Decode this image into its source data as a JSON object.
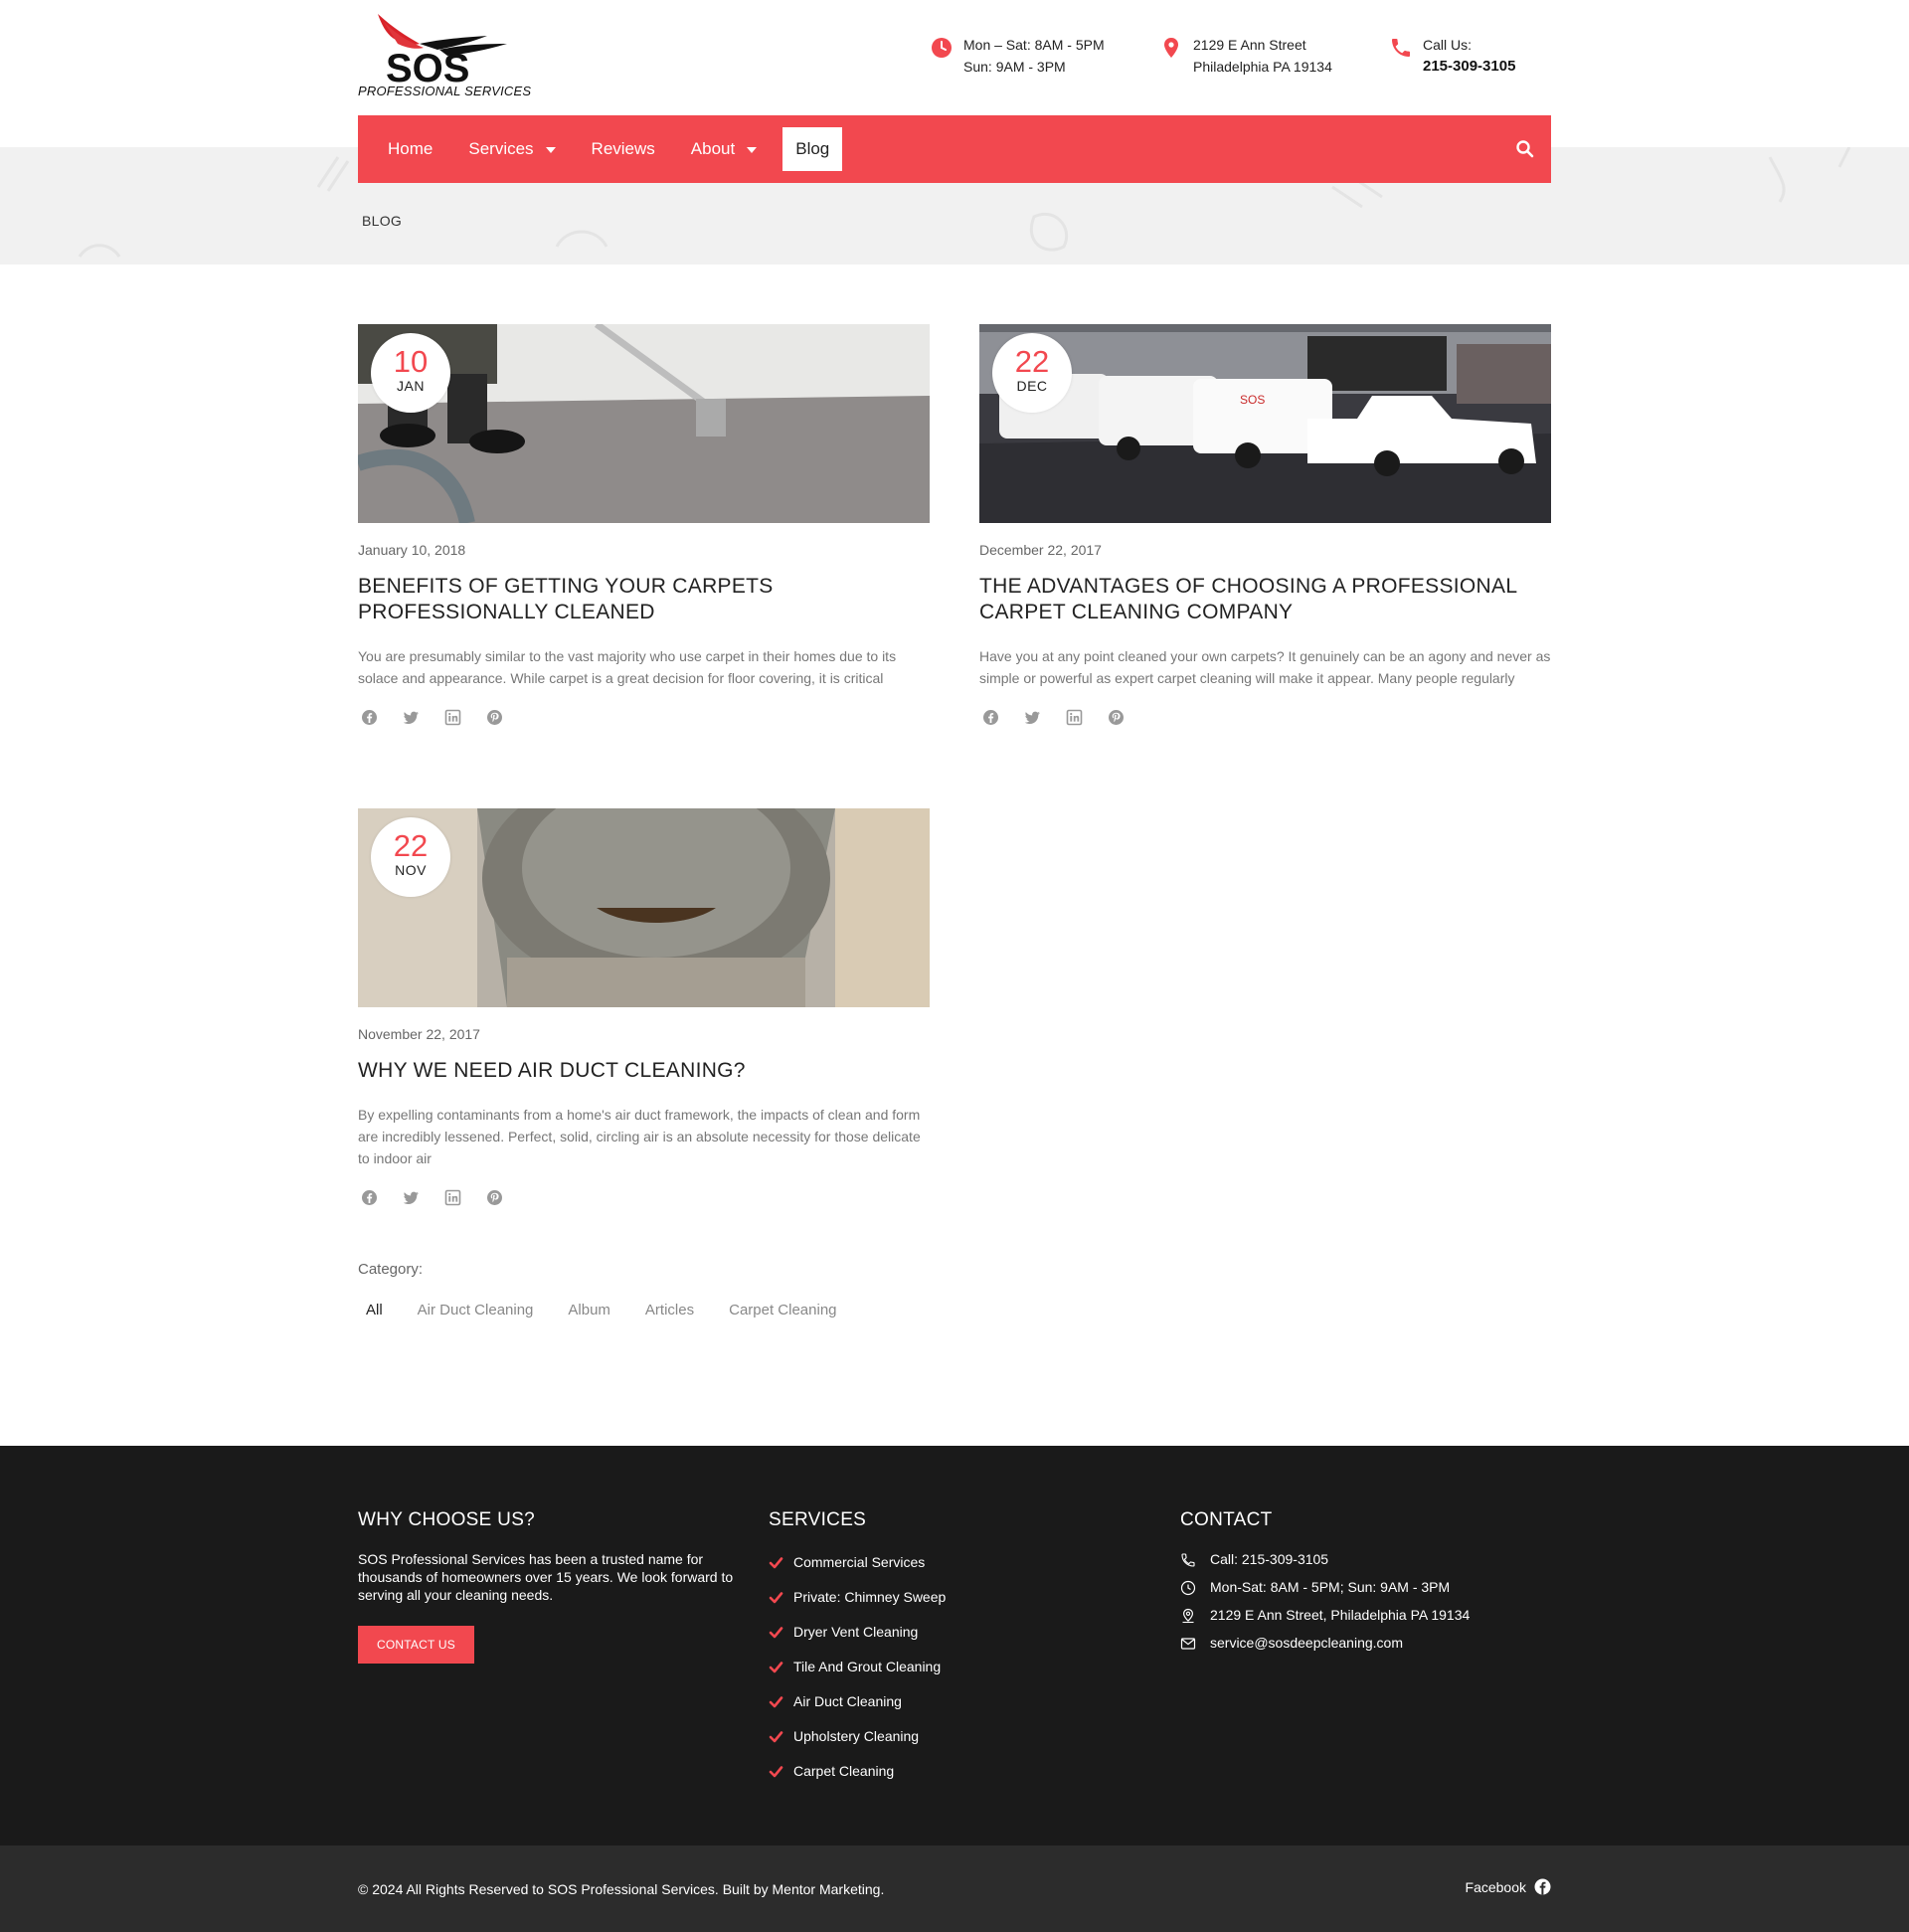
{
  "header": {
    "logo_text": "SOS",
    "logo_subtitle": "PROFESSIONAL SERVICES",
    "hours": [
      "Mon – Sat: 8AM - 5PM",
      "Sun: 9AM - 3PM"
    ],
    "address": [
      "2129 E Ann Street",
      "Philadelphia PA 19134"
    ],
    "call_label": "Call Us:",
    "call_number": "215-309-3105"
  },
  "nav": {
    "items": [
      {
        "label": "Home"
      },
      {
        "label": "Services"
      },
      {
        "label": "Reviews"
      },
      {
        "label": "About"
      },
      {
        "label": "Blog"
      }
    ]
  },
  "breadcrumb": "BLOG",
  "posts": [
    {
      "day": "10",
      "month": "JAN",
      "date": "January 10, 2018",
      "title": "Benefits of Getting your Carpets Professionally Cleaned",
      "excerpt": "You are presumably similar to the vast majority who use carpet  in  their homes due to its solace and appearance. While carpet is a great decision for floor covering, it is critical"
    },
    {
      "day": "22",
      "month": "DEC",
      "date": "December 22, 2017",
      "title": "The Advantages of Choosing a Professional Carpet Cleaning Company",
      "excerpt": "Have you at any point cleaned your own carpets? It genuinely can be an agony and never as simple or powerful as expert carpet cleaning will make it appear. Many people regularly"
    },
    {
      "day": "22",
      "month": "NOV",
      "date": "November 22, 2017",
      "title": "Why We Need Air Duct Cleaning?",
      "excerpt": "By expelling contaminants from a home's air duct framework, the impacts of clean and form are incredibly lessened. Perfect, solid, circling air is an absolute necessity for those delicate to indoor air"
    }
  ],
  "category": {
    "label": "Category:",
    "tabs": [
      "All",
      "Air Duct Cleaning",
      "Album",
      "Articles",
      "Carpet Cleaning"
    ]
  },
  "footer": {
    "why_title": "WHY CHOOSE US?",
    "why_text": "SOS Professional Services has been a trusted name for thousands of homeowners over 15 years. We look forward to serving all your cleaning needs.",
    "contact_button": "CONTACT US",
    "services_title": "SERVICES",
    "services": [
      "Commercial Services",
      "Private: Chimney Sweep",
      "Dryer Vent Cleaning",
      "Tile And Grout Cleaning",
      "Air Duct Cleaning",
      "Upholstery Cleaning",
      "Carpet Cleaning"
    ],
    "contact_title": "CONTACT",
    "contact": [
      "Call: 215-309-3105",
      "Mon-Sat: 8AM - 5PM; Sun: 9AM - 3PM",
      "2129 E Ann Street, Philadelphia PA 19134",
      "service@sosdeepcleaning.com"
    ],
    "copyright": "© 2024 All Rights Reserved to SOS Professional Services. Built by Mentor Marketing.",
    "facebook_label": "Facebook"
  },
  "colors": {
    "accent": "#f2484f",
    "footer_bg": "#1a1a1a",
    "bottom_bar_bg": "#2c2c2c"
  },
  "icons": [
    "clock-icon",
    "location-pin-icon",
    "phone-icon",
    "search-icon",
    "facebook-icon",
    "twitter-icon",
    "linkedin-icon",
    "pinterest-icon",
    "check-icon",
    "mail-icon"
  ]
}
